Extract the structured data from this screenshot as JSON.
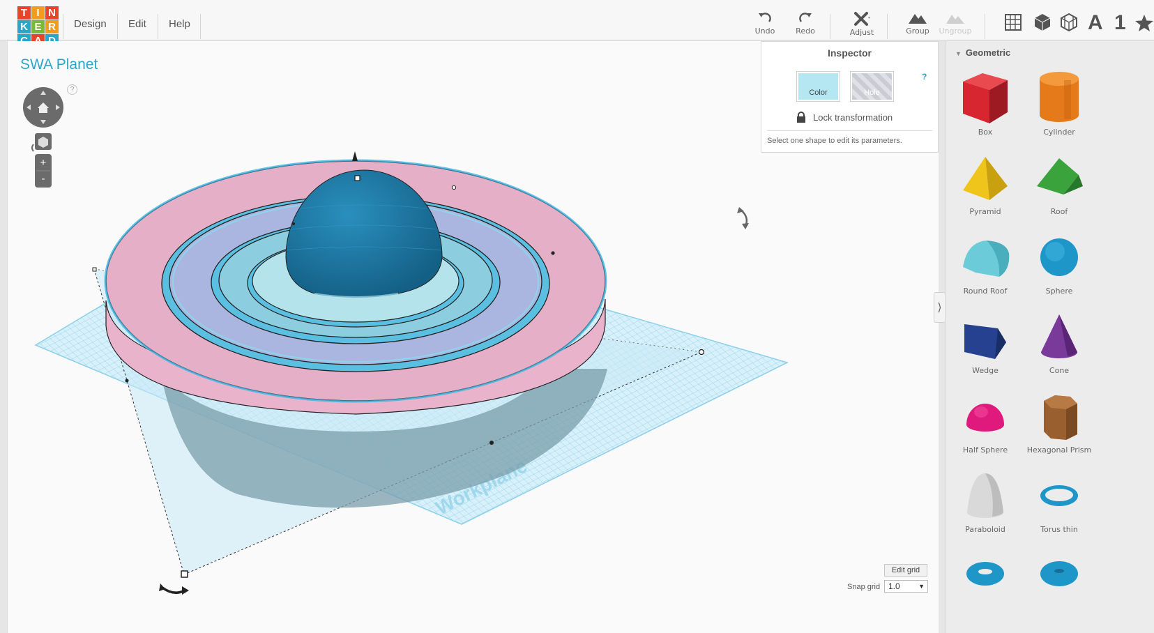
{
  "app": {
    "logo_letters": [
      "T",
      "I",
      "N",
      "K",
      "E",
      "R",
      "C",
      "A",
      "D"
    ],
    "logo_colors": [
      "#e8432b",
      "#f29c1f",
      "#e8432b",
      "#2aa6c9",
      "#7ab938",
      "#f29c1f",
      "#2aa6c9",
      "#e8432b",
      "#2aa6c9"
    ]
  },
  "menu": {
    "design": "Design",
    "edit": "Edit",
    "help": "Help"
  },
  "toolbar": {
    "undo": "Undo",
    "redo": "Redo",
    "adjust": "Adjust",
    "group": "Group",
    "ungroup": "Ungroup",
    "view_text_icon": "A",
    "view_number_icon": "1"
  },
  "design": {
    "title": "SWA Planet",
    "workplane_label": "Workplane"
  },
  "nav": {
    "help": "?",
    "zoom_in": "+",
    "zoom_out": "-"
  },
  "inspector": {
    "title": "Inspector",
    "color_label": "Color",
    "hole_label": "Hole",
    "help": "?",
    "lock_label": "Lock transformation",
    "message": "Select one shape to edit its parameters."
  },
  "library": {
    "header": "Geometric",
    "shapes": [
      {
        "label": "Box",
        "color": "#d7262f"
      },
      {
        "label": "Cylinder",
        "color": "#e57a1a"
      },
      {
        "label": "Pyramid",
        "color": "#efc51c"
      },
      {
        "label": "Roof",
        "color": "#3aa33c"
      },
      {
        "label": "Round Roof",
        "color": "#6ccbd8"
      },
      {
        "label": "Sphere",
        "color": "#1e96c8"
      },
      {
        "label": "Wedge",
        "color": "#25418f"
      },
      {
        "label": "Cone",
        "color": "#7a3a9a"
      },
      {
        "label": "Half Sphere",
        "color": "#e0197d"
      },
      {
        "label": "Hexagonal Prism",
        "color": "#9a5f2f"
      },
      {
        "label": "Paraboloid",
        "color": "#d9d9d9"
      },
      {
        "label": "Torus thin",
        "color": "#1e96c8"
      },
      {
        "label": "",
        "color": "#1e96c8"
      },
      {
        "label": "",
        "color": "#1e96c8"
      }
    ]
  },
  "grid": {
    "edit_grid": "Edit grid",
    "snap_label": "Snap grid",
    "snap_value": "1.0"
  },
  "colors": {
    "accent": "#2aa6c9",
    "planet": "#1f7fa8",
    "outer_ring": "#e6afc8",
    "middle_ring": "#aab6e0",
    "inner_ring": "#9cd8e5",
    "workplane": "#bfe6f5"
  }
}
